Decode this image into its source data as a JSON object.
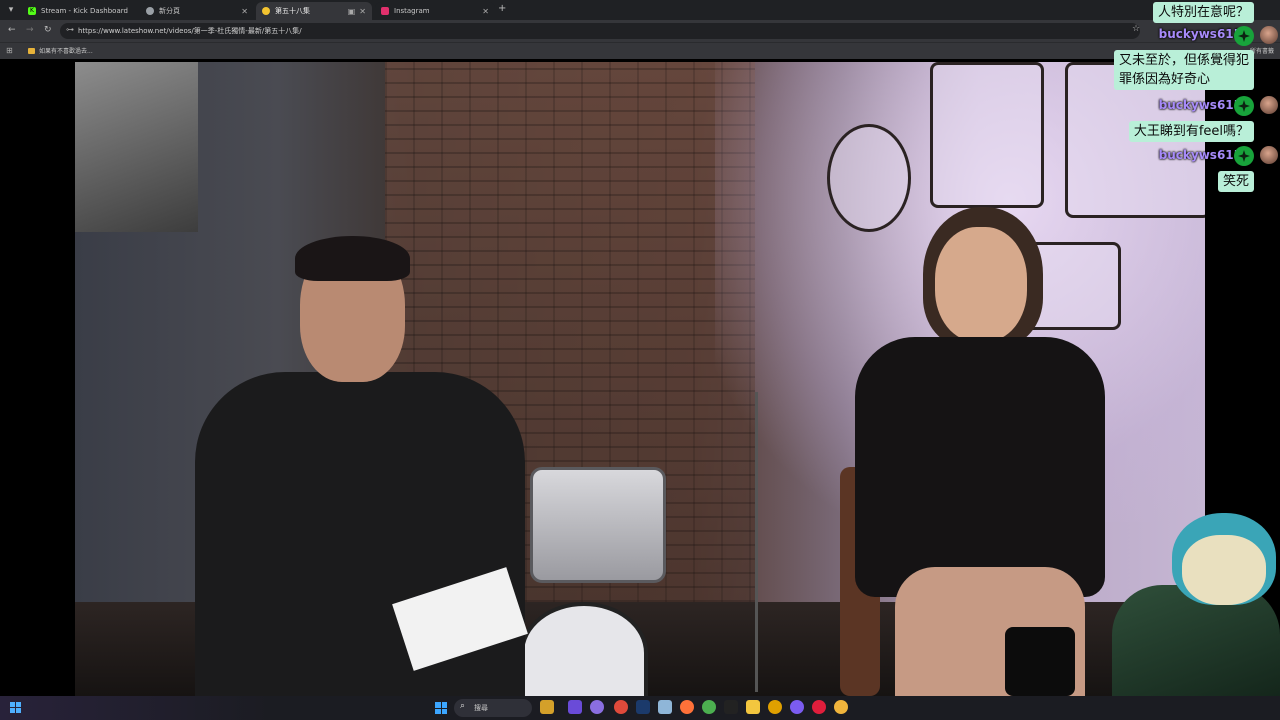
{
  "browser": {
    "tabs": [
      {
        "title": "Stream - Kick Dashboard",
        "fav_color": "#53fc18",
        "fav_glyph": "K"
      },
      {
        "title": "新分頁",
        "fav_color": "#9aa0a6",
        "fav_glyph": ""
      },
      {
        "title": "第五十八集",
        "fav_color": "#f4c430",
        "fav_glyph": ""
      },
      {
        "title": "Instagram",
        "fav_color": "#e1306c",
        "fav_glyph": ""
      }
    ],
    "new_tab": "+",
    "url": "https://www.lateshow.net/videos/第一季-杜氏獨情-最新/第五十八集/",
    "bookmark": "如果有不喜歡過去...",
    "bookmark_right": "所有書籤"
  },
  "chat": {
    "messages": [
      {
        "user": "",
        "text": "人特別在意呢？"
      },
      {
        "user": "buckyws615",
        "text": ""
      },
      {
        "user": "",
        "text": "又未至於，但係覺得犯\n罪係因為好奇心"
      },
      {
        "user": "buckyws615",
        "text": "大王睇到有feel嗎？"
      },
      {
        "user": "buckyws615",
        "text": "笑死"
      }
    ],
    "username_color": "#a78bfa",
    "bubble_color": "#b9efd8",
    "badge_color": "#18a33b"
  },
  "taskbar": {
    "search_placeholder": "搜尋",
    "apps": [
      "pwa",
      "chat",
      "chrome-dev",
      "steam",
      "wallet",
      "firefox",
      "chrome",
      "xbox",
      "explorer",
      "vscode",
      "discord",
      "opera",
      "chrome-canary",
      "chrome-beta",
      "obs"
    ]
  }
}
